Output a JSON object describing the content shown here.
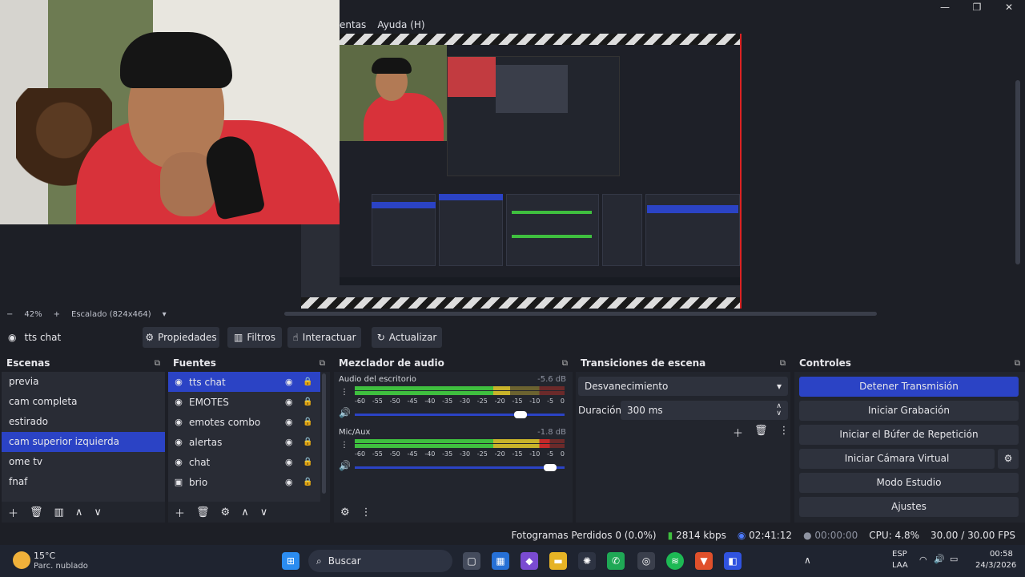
{
  "menu": {
    "items": [
      "entas",
      "Ayuda (H)"
    ]
  },
  "window": {
    "minimize": "—",
    "maximize": "❐",
    "close": "✕"
  },
  "preview": {
    "zoom_minus": "−",
    "zoom": "42%",
    "zoom_plus": "+",
    "scale": "Escalado (824x464)",
    "dropdown": "▾"
  },
  "source_toolbar": {
    "source_name": "tts chat",
    "buttons": [
      {
        "label": "Propiedades",
        "icon": "gear-icon"
      },
      {
        "label": "Filtros",
        "icon": "filter-icon"
      },
      {
        "label": "Interactuar",
        "icon": "interact-icon"
      },
      {
        "label": "Actualizar",
        "icon": "refresh-icon"
      }
    ]
  },
  "scenes": {
    "title": "Escenas",
    "items": [
      "previa",
      "cam completa",
      "estirado",
      "cam superior izquierda",
      "ome tv",
      "fnaf"
    ],
    "selected_index": 3
  },
  "sources": {
    "title": "Fuentes",
    "items": [
      {
        "name": "tts chat",
        "icon": "browser-icon"
      },
      {
        "name": "EMOTES",
        "icon": "browser-icon"
      },
      {
        "name": "emotes combo",
        "icon": "browser-icon"
      },
      {
        "name": "alertas",
        "icon": "browser-icon"
      },
      {
        "name": "chat",
        "icon": "browser-icon"
      },
      {
        "name": "brio",
        "icon": "camera-icon"
      }
    ],
    "selected_index": 0
  },
  "mixer": {
    "title": "Mezclador de audio",
    "tracks": [
      {
        "name": "Audio del escritorio",
        "db": "-5.6 dB",
        "level": 0.74,
        "volume": 0.79
      },
      {
        "name": "Mic/Aux",
        "db": "-1.8 dB",
        "level": 0.93,
        "volume": 0.93
      }
    ],
    "scale": [
      "-60",
      "-55",
      "-50",
      "-45",
      "-40",
      "-35",
      "-30",
      "-25",
      "-20",
      "-15",
      "-10",
      "-5",
      "0"
    ]
  },
  "transitions": {
    "title": "Transiciones de escena",
    "selected": "Desvanecimiento",
    "duration_label": "Duración",
    "duration": "300 ms"
  },
  "controls": {
    "title": "Controles",
    "buttons": [
      "Detener Transmisión",
      "Iniciar Grabación",
      "Iniciar el Búfer de Repetición",
      "Iniciar Cámara Virtual",
      "Modo Estudio",
      "Ajustes"
    ]
  },
  "status": {
    "dropped": "Fotogramas Perdidos 0 (0.0%)",
    "bitrate": "2814 kbps",
    "stream_time": "02:41:12",
    "rec_time": "00:00:00",
    "cpu": "CPU: 4.8%",
    "fps": "30.00 / 30.00 FPS"
  },
  "taskbar": {
    "weather_temp": "15°C",
    "weather_desc": "Parc. nublado",
    "search_placeholder": "Buscar",
    "lang_1": "ESP",
    "lang_2": "LAA",
    "time": "00:58",
    "date": "24/3/2026"
  },
  "colors": {
    "accent": "#2b43c5",
    "live_border": "#dd2222",
    "meter_green": "#3fbf3f",
    "meter_yellow": "#c8b32a",
    "meter_red": "#c42a2a"
  }
}
